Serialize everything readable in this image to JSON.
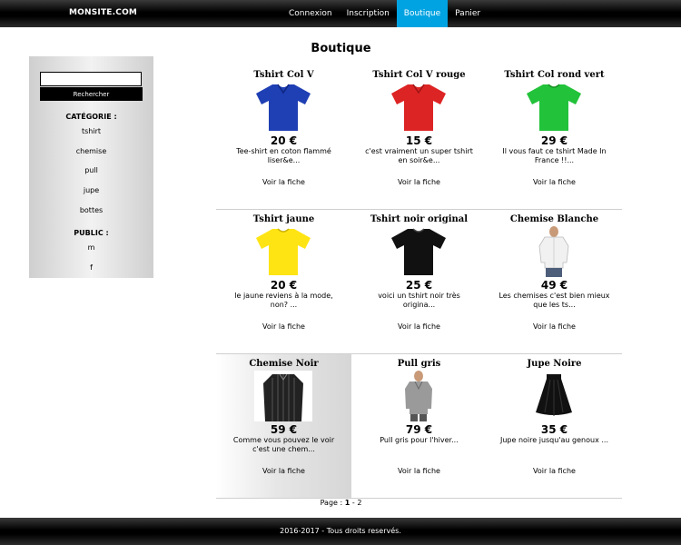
{
  "header": {
    "brand": "MONSITE.COM",
    "nav": [
      {
        "label": "Connexion",
        "active": false
      },
      {
        "label": "Inscription",
        "active": false
      },
      {
        "label": "Boutique",
        "active": true
      },
      {
        "label": "Panier",
        "active": false
      }
    ],
    "accent_color": "#00a3e2"
  },
  "page_title": "Boutique",
  "sidebar": {
    "search": {
      "value": "",
      "button_label": "Rechercher"
    },
    "category_heading": "CATÉGORIE :",
    "categories": [
      "tshirt",
      "chemise",
      "pull",
      "jupe",
      "bottes"
    ],
    "public_heading": "PUBLIC :",
    "publics": [
      "m",
      "f"
    ]
  },
  "products": [
    {
      "title": "Tshirt Col V",
      "price": "20 €",
      "desc": "Tee-shirt en coton flammé liser&e...",
      "link": "Voir la fiche",
      "image": "blue-tshirt",
      "color": "#1f3fb4"
    },
    {
      "title": "Tshirt Col V rouge",
      "price": "15 €",
      "desc": "c'est vraiment un super tshirt en soir&e...",
      "link": "Voir la fiche",
      "image": "red-tshirt",
      "color": "#dd2424"
    },
    {
      "title": "Tshirt Col rond vert",
      "price": "29 €",
      "desc": "Il vous faut ce tshirt Made In France !!...",
      "link": "Voir la fiche",
      "image": "green-tshirt",
      "color": "#22c23a"
    },
    {
      "title": "Tshirt jaune",
      "price": "20 €",
      "desc": "le jaune reviens à la mode, non? ...",
      "link": "Voir la fiche",
      "image": "yellow-tshirt",
      "color": "#ffe414"
    },
    {
      "title": "Tshirt noir original",
      "price": "25 €",
      "desc": "voici un tshirt noir très origina...",
      "link": "Voir la fiche",
      "image": "black-tshirt",
      "color": "#111111"
    },
    {
      "title": "Chemise Blanche",
      "price": "49 €",
      "desc": "Les chemises c'est bien mieux que les ts...",
      "link": "Voir la fiche",
      "image": "white-shirt-model",
      "color": "#eeeeee"
    },
    {
      "title": "Chemise Noir",
      "price": "59 €",
      "desc": "Comme vous pouvez le voir c'est une chem...",
      "link": "Voir la fiche",
      "image": "black-shirt",
      "color": "#222222"
    },
    {
      "title": "Pull gris",
      "price": "79 €",
      "desc": "Pull gris pour l'hiver...",
      "link": "Voir la fiche",
      "image": "grey-pullover-model",
      "color": "#9a9a9a"
    },
    {
      "title": "Jupe Noire",
      "price": "35 €",
      "desc": "Jupe noire jusqu'au genoux ...",
      "link": "Voir la fiche",
      "image": "black-skirt",
      "color": "#111111"
    }
  ],
  "pagination": {
    "label": "Page :",
    "current": "1",
    "separator": "-",
    "other": "2"
  },
  "footer": "2016-2017 - Tous droits reservés."
}
